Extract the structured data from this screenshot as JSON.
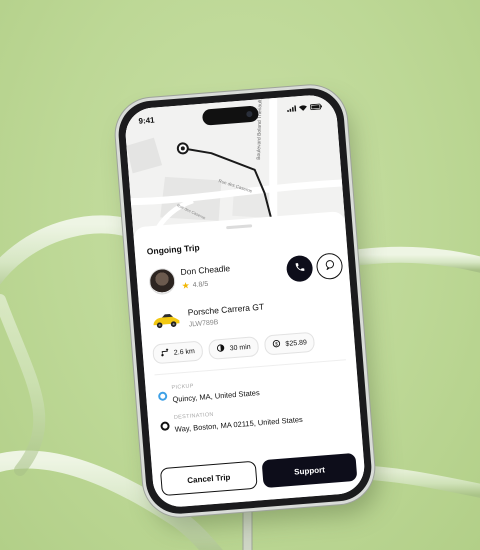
{
  "status": {
    "time": "9:41"
  },
  "map": {
    "street_vertical": "Boulevard Boland Theriault",
    "street_horizontal": "Rue des Caserne",
    "street_small": "Rue des Caserne"
  },
  "trip": {
    "title": "Ongoing Trip"
  },
  "driver": {
    "name": "Don Cheadle",
    "rating": "4.8/5"
  },
  "car": {
    "name": "Porsche Carrera GT",
    "plate": "JLW789B"
  },
  "stats": {
    "distance": "2.6 km",
    "time": "30 min",
    "price": "$25.89"
  },
  "pickup": {
    "label": "PICKUP",
    "value": "Quincy, MA, United States",
    "color": "#3ea0e6"
  },
  "destination": {
    "label": "DESTINATION",
    "value": "Way, Boston, MA 02115, United States",
    "color": "#111111"
  },
  "actions": {
    "cancel": "Cancel Trip",
    "support": "Support"
  },
  "colors": {
    "background": "#bdd896",
    "primary": "#0d0d1a",
    "star": "#f2b705",
    "car": "#f2c811"
  },
  "icons": {
    "call": "phone-icon",
    "chat": "chat-icon",
    "distance": "route-icon",
    "duration": "clock-icon",
    "price": "dollar-icon"
  }
}
